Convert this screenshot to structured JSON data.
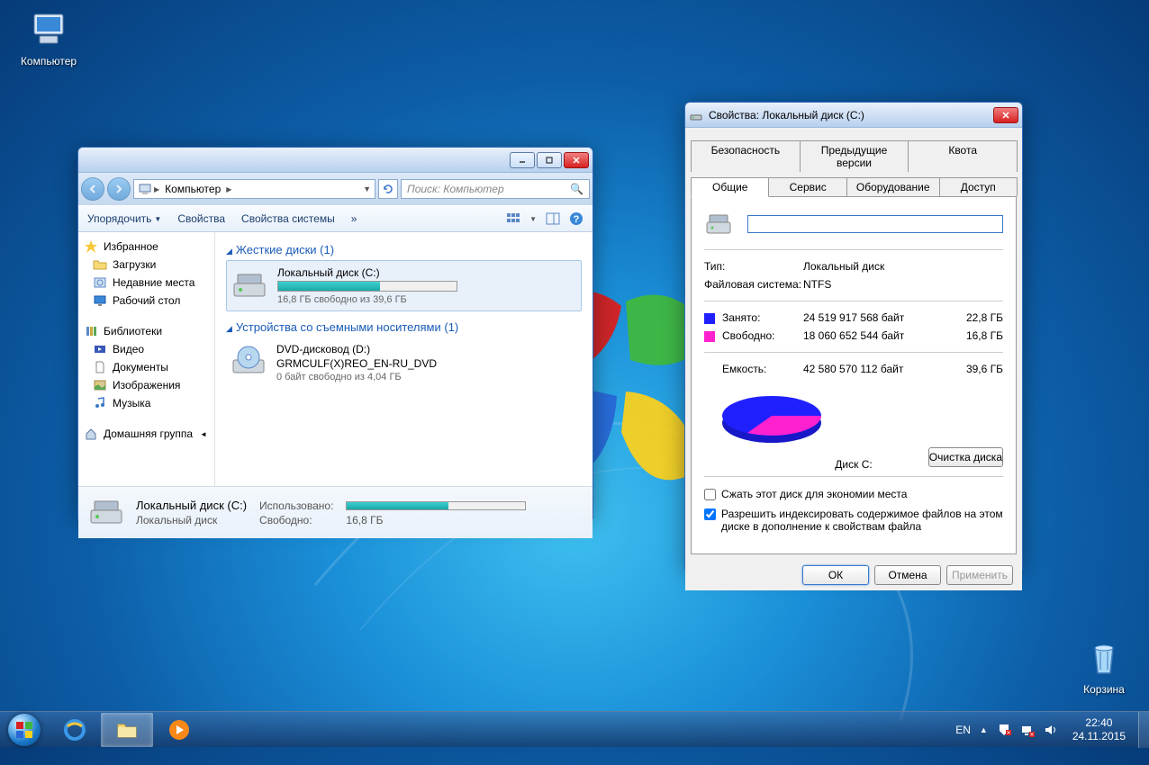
{
  "desktop": {
    "icons": {
      "computer": "Компьютер",
      "recycle": "Корзина"
    }
  },
  "explorer": {
    "breadcrumb_root_icon": "computer",
    "breadcrumb_label": "Компьютер",
    "search_placeholder": "Поиск: Компьютер",
    "toolbar": {
      "organize": "Упорядочить",
      "properties": "Свойства",
      "system_properties": "Свойства системы"
    },
    "nav": {
      "favorites": "Избранное",
      "downloads": "Загрузки",
      "recent": "Недавние места",
      "desktop": "Рабочий стол",
      "libraries": "Библиотеки",
      "video": "Видео",
      "documents": "Документы",
      "pictures": "Изображения",
      "music": "Музыка",
      "homegroup": "Домашняя группа"
    },
    "groups": {
      "hard_drives": "Жесткие диски (1)",
      "removable": "Устройства со съемными носителями (1)"
    },
    "drive_c": {
      "name": "Локальный диск (C:)",
      "free_text": "16,8 ГБ свободно из 39,6 ГБ",
      "fill_percent": 57
    },
    "drive_d": {
      "name": "DVD-дисковод (D:)",
      "label": "GRMCULF(X)REO_EN-RU_DVD",
      "free_text": "0 байт свободно из 4,04 ГБ"
    },
    "details": {
      "title": "Локальный диск (C:)",
      "type": "Локальный диск",
      "used_label": "Использовано:",
      "free_label": "Свободно:",
      "free_value": "16,8 ГБ",
      "fill_percent": 57
    }
  },
  "props": {
    "title": "Свойства: Локальный диск (C:)",
    "tabs_row1": {
      "security": "Безопасность",
      "prev": "Предыдущие версии",
      "quota": "Квота"
    },
    "tabs_row2": {
      "general": "Общие",
      "service": "Сервис",
      "hardware": "Оборудование",
      "access": "Доступ"
    },
    "name_value": "",
    "type_label": "Тип:",
    "type_value": "Локальный диск",
    "fs_label": "Файловая система:",
    "fs_value": "NTFS",
    "used_label": "Занято:",
    "used_bytes": "24 519 917 568 байт",
    "used_gb": "22,8 ГБ",
    "free_label": "Свободно:",
    "free_bytes": "18 060 652 544 байт",
    "free_gb": "16,8 ГБ",
    "cap_label": "Емкость:",
    "cap_bytes": "42 580 570 112 байт",
    "cap_gb": "39,6 ГБ",
    "pie_caption": "Диск C:",
    "cleanup": "Очистка диска",
    "compress": "Сжать этот диск для экономии места",
    "index": "Разрешить индексировать содержимое файлов на этом диске в дополнение к свойствам файла",
    "ok": "ОК",
    "cancel": "Отмена",
    "apply": "Применить"
  },
  "taskbar": {
    "lang": "EN",
    "time": "22:40",
    "date": "24.11.2015"
  },
  "colors": {
    "used": "#2020ff",
    "free": "#ff20d0"
  },
  "chart_data": {
    "type": "pie",
    "title": "Диск C:",
    "series": [
      {
        "name": "Занято",
        "value": 24519917568,
        "display": "22,8 ГБ",
        "color": "#2020ff"
      },
      {
        "name": "Свободно",
        "value": 18060652544,
        "display": "16,8 ГБ",
        "color": "#ff20d0"
      }
    ],
    "total": {
      "name": "Емкость",
      "value": 42580570112,
      "display": "39,6 ГБ"
    }
  }
}
